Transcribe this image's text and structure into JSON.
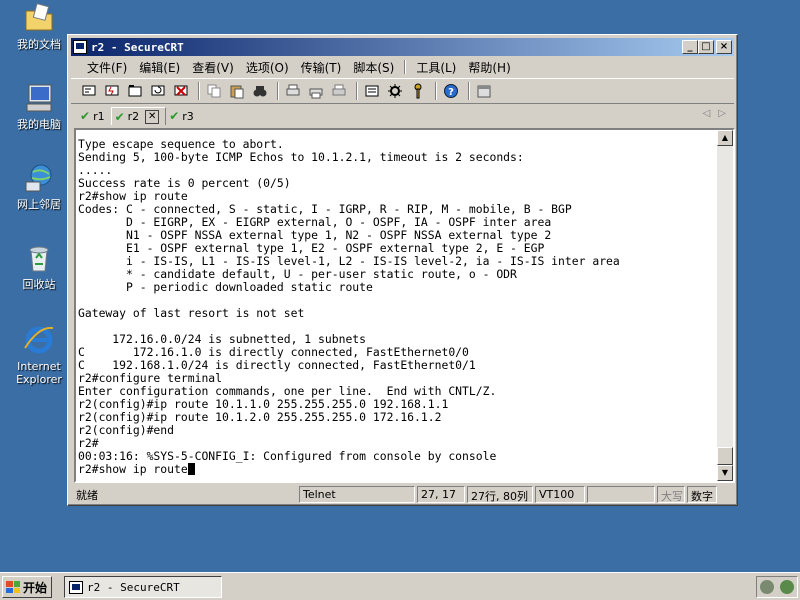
{
  "desktop": {
    "icons": [
      {
        "label": "我的文档",
        "icon": "folder-documents-icon"
      },
      {
        "label": "我的电脑",
        "icon": "computer-icon"
      },
      {
        "label": "网上邻居",
        "icon": "network-icon"
      },
      {
        "label": "回收站",
        "icon": "recycle-bin-icon"
      },
      {
        "label": "Internet Explorer",
        "icon": "internet-explorer-icon"
      }
    ]
  },
  "window": {
    "title": "r2 - SecureCRT",
    "controls": {
      "minimize": "_",
      "maximize": "□",
      "close": "×"
    }
  },
  "menu": {
    "items": [
      "文件(F)",
      "编辑(E)",
      "查看(V)",
      "选项(O)",
      "传输(T)",
      "脚本(S)",
      "工具(L)",
      "帮助(H)"
    ]
  },
  "tabs": [
    {
      "label": "r1",
      "active": false
    },
    {
      "label": "r2",
      "active": true
    },
    {
      "label": "r3",
      "active": false
    }
  ],
  "terminal": {
    "lines": [
      "Type escape sequence to abort.",
      "Sending 5, 100-byte ICMP Echos to 10.1.2.1, timeout is 2 seconds:",
      ".....",
      "Success rate is 0 percent (0/5)",
      "r2#show ip route",
      "Codes: C - connected, S - static, I - IGRP, R - RIP, M - mobile, B - BGP",
      "       D - EIGRP, EX - EIGRP external, O - OSPF, IA - OSPF inter area",
      "       N1 - OSPF NSSA external type 1, N2 - OSPF NSSA external type 2",
      "       E1 - OSPF external type 1, E2 - OSPF external type 2, E - EGP",
      "       i - IS-IS, L1 - IS-IS level-1, L2 - IS-IS level-2, ia - IS-IS inter area",
      "       * - candidate default, U - per-user static route, o - ODR",
      "       P - periodic downloaded static route",
      "",
      "Gateway of last resort is not set",
      "",
      "     172.16.0.0/24 is subnetted, 1 subnets",
      "C       172.16.1.0 is directly connected, FastEthernet0/0",
      "C    192.168.1.0/24 is directly connected, FastEthernet0/1",
      "r2#configure terminal",
      "Enter configuration commands, one per line.  End with CNTL/Z.",
      "r2(config)#ip route 10.1.1.0 255.255.255.0 192.168.1.1",
      "r2(config)#ip route 10.1.2.0 255.255.255.0 172.16.1.2",
      "r2(config)#end",
      "r2#",
      "00:03:16: %SYS-5-CONFIG_I: Configured from console by console"
    ],
    "prompt_line": "r2#show ip route"
  },
  "statusbar": {
    "ready": "就绪",
    "protocol": "Telnet",
    "cursor_pos": "27, 17",
    "size": "27行, 80列",
    "emulation": "VT100",
    "caps": "大写",
    "num": "数字"
  },
  "taskbar": {
    "start_label": "开始",
    "task_label": "r2 - SecureCRT"
  }
}
